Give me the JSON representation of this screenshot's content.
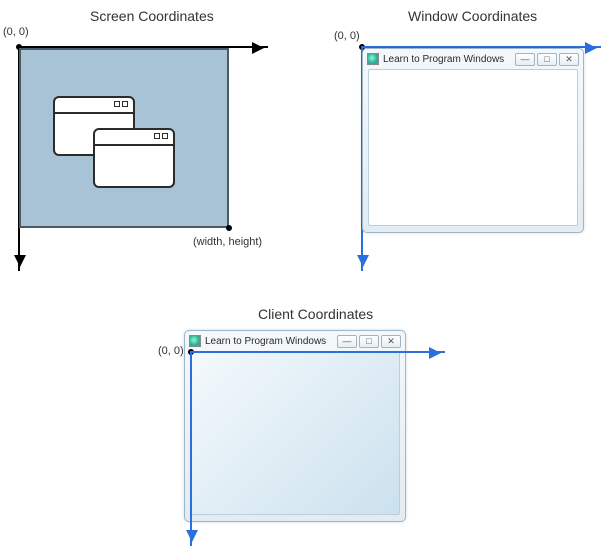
{
  "panels": {
    "screen": {
      "title": "Screen Coordinates",
      "origin": "(0, 0)",
      "bottom_label": "(width, height)"
    },
    "window": {
      "title": "Window Coordinates",
      "origin": "(0, 0)",
      "app_title": "Learn to Program Windows"
    },
    "client": {
      "title": "Client Coordinates",
      "origin": "(0, 0)",
      "app_title": "Learn to Program Windows"
    }
  },
  "icons": {
    "minimize": "—",
    "maximize": "□",
    "close": "✕"
  }
}
